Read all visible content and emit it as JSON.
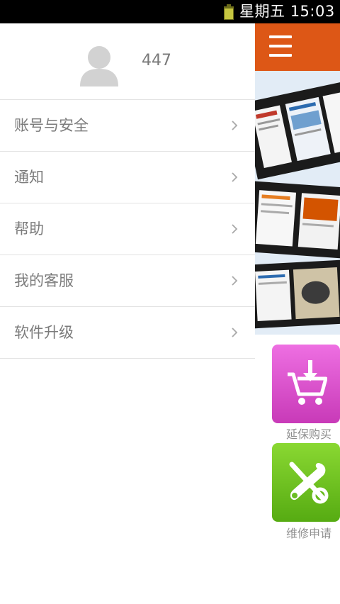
{
  "status_bar": {
    "day": "星期五",
    "time": "15:03",
    "icons": [
      "battery-icon"
    ]
  },
  "profile": {
    "username": "447",
    "avatar_icon": "default-avatar-icon"
  },
  "menu": {
    "items": [
      {
        "label": "账号与安全",
        "icon": "chevron-right-icon"
      },
      {
        "label": "通知",
        "icon": "chevron-right-icon"
      },
      {
        "label": "帮助",
        "icon": "chevron-right-icon"
      },
      {
        "label": "我的客服",
        "icon": "chevron-right-icon"
      },
      {
        "label": "软件升级",
        "icon": "chevron-right-icon"
      }
    ]
  },
  "main": {
    "header_icon": "hamburger-menu-icon",
    "banner_icon": "film-strip-newspapers-image",
    "tiles": [
      {
        "label": "延保购买",
        "icon": "cart-download-icon",
        "color": "#e25fd6"
      },
      {
        "label": "维修申请",
        "icon": "tools-icon",
        "color": "#74c424"
      }
    ]
  },
  "colors": {
    "accent": "#dd5716",
    "status_bar": "#000000",
    "menu_text": "#7b7b7b",
    "divider": "#e3e3e3"
  }
}
